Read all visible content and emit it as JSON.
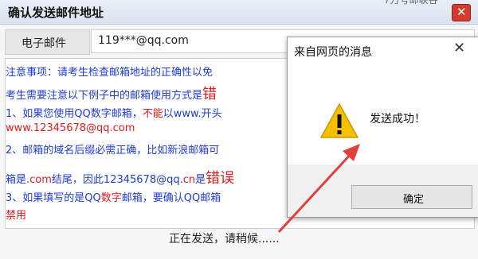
{
  "window": {
    "title": "确认发送邮件地址",
    "bg_text": "7万号邮联谷"
  },
  "email": {
    "label": "电子邮件",
    "value": "119***@qq.com"
  },
  "notice": {
    "line1": "注意事项：请考生检查邮箱地址的正确性以免",
    "line2_a": "考生需要注意以下例子中的邮箱使用方式是",
    "line2_b": "错",
    "line3_a": "1、如果您使用QQ数字邮箱，",
    "line3_b": "不能",
    "line3_c": "以www.开头",
    "line4": "www.12345678@qq.com",
    "line5": "2、邮箱的域名后缀必需正确，比如新浪邮箱可",
    "line6_a": "箱是",
    "line6_b": ".com",
    "line6_c": "结尾，因此12345678@qq.",
    "line6_d": "cn",
    "line6_e": "是",
    "line6_f": "错误",
    "line7_a": "3、如果填写的是QQ",
    "line7_b": "数字",
    "line7_c": "邮箱，要确认QQ邮箱",
    "line8": "禁用"
  },
  "status": "正在发送，请稍候......",
  "dialog": {
    "title": "来自网页的消息",
    "close": "✕",
    "message": "发送成功！",
    "ok_label": "确定"
  },
  "colors": {
    "text_blue": "#1f3bd6",
    "text_red": "#e01b1b",
    "close_red": "#d33b2f",
    "warning_yellow": "#f6c000",
    "arrow_red": "#e0413a"
  }
}
